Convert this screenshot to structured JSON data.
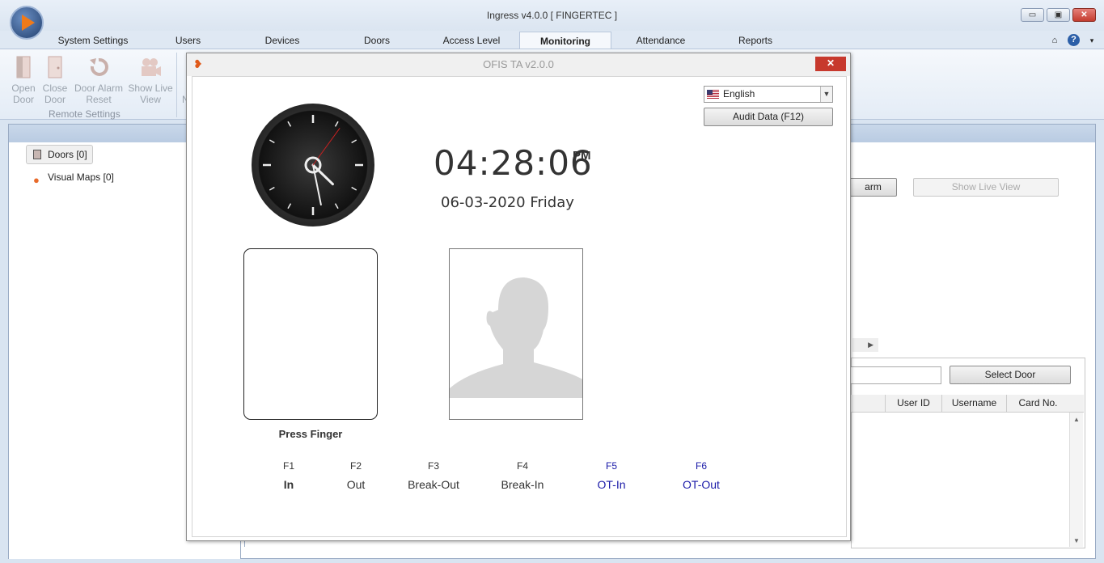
{
  "app": {
    "title": "Ingress v4.0.0 [ FINGERTEC ]",
    "window_buttons": [
      "▭",
      "▣",
      "✕"
    ]
  },
  "ribbon": {
    "tabs": [
      "System Settings",
      "Users",
      "Devices",
      "Doors",
      "Access Level",
      "Monitoring",
      "Attendance",
      "Reports"
    ],
    "active_tab": "Monitoring",
    "buttons": [
      {
        "line1": "Open",
        "line2": "Door"
      },
      {
        "line1": "Close",
        "line2": "Door"
      },
      {
        "line1": "Door Alarm",
        "line2": "Reset"
      },
      {
        "line1": "Show Live",
        "line2": "View"
      }
    ],
    "clipped_label": "N",
    "group_label": "Remote Settings"
  },
  "tree": {
    "doors": "Doors [0]",
    "visual_maps": "Visual Maps [0]"
  },
  "main": {
    "alarm_button": "arm",
    "live_view_button": "Show Live View",
    "select_door_button": "Select Door",
    "grid_columns": [
      "User ID",
      "Username",
      "Card No."
    ]
  },
  "dialog": {
    "title": "OFIS TA v2.0.0",
    "close": "✕",
    "language": "English",
    "audit_button": "Audit Data (F12)",
    "time": "04:28:06",
    "ampm": "PM",
    "date": "06-03-2020 Friday",
    "press_finger": "Press Finger",
    "clock": {
      "hour": 4,
      "minute": 28,
      "second": 6
    },
    "function_keys": [
      {
        "key": "F1",
        "label": "In",
        "style": "bold"
      },
      {
        "key": "F2",
        "label": "Out",
        "style": "normal"
      },
      {
        "key": "F3",
        "label": "Break-Out",
        "style": "normal"
      },
      {
        "key": "F4",
        "label": "Break-In",
        "style": "normal"
      },
      {
        "key": "F5",
        "label": "OT-In",
        "style": "blue"
      },
      {
        "key": "F6",
        "label": "OT-Out",
        "style": "blue"
      }
    ]
  },
  "colors": {
    "accent_red": "#c7392d",
    "ribbon_bg": "#dfe8f3",
    "link_blue": "#1a1aa8"
  }
}
